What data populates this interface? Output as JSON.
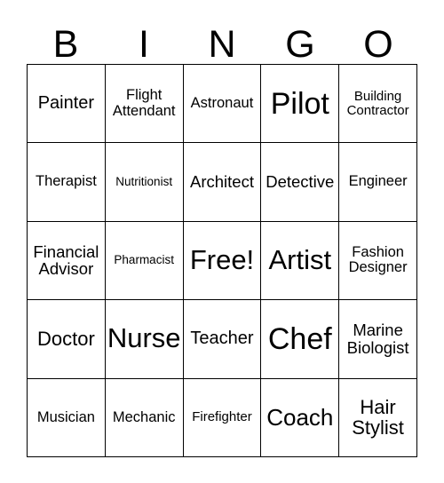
{
  "card": {
    "title": "BINGO",
    "header_letters": [
      "B",
      "I",
      "N",
      "G",
      "O"
    ],
    "border_color": "#000000",
    "background_color": "#ffffff",
    "text_color": "#000000",
    "rows": 5,
    "columns": 5,
    "free_space": "Free!",
    "cells": [
      {
        "label": "Painter",
        "size": "ml"
      },
      {
        "label": "Flight Attendant",
        "size": "sm"
      },
      {
        "label": "Astronaut",
        "size": "sm"
      },
      {
        "label": "Pilot",
        "size": "huge"
      },
      {
        "label": "Building Contractor",
        "size": "s"
      },
      {
        "label": "Therapist",
        "size": "sm"
      },
      {
        "label": "Nutritionist",
        "size": "xs"
      },
      {
        "label": "Architect",
        "size": "m"
      },
      {
        "label": "Detective",
        "size": "m"
      },
      {
        "label": "Engineer",
        "size": "sm"
      },
      {
        "label": "Financial Advisor",
        "size": "m"
      },
      {
        "label": "Pharmacist",
        "size": "xs"
      },
      {
        "label": "Free!",
        "size": "xxl"
      },
      {
        "label": "Artist",
        "size": "xxl"
      },
      {
        "label": "Fashion Designer",
        "size": "sm"
      },
      {
        "label": "Doctor",
        "size": "l"
      },
      {
        "label": "Nurse",
        "size": "xxl"
      },
      {
        "label": "Teacher",
        "size": "ml"
      },
      {
        "label": "Chef",
        "size": "huge"
      },
      {
        "label": "Marine Biologist",
        "size": "m"
      },
      {
        "label": "Musician",
        "size": "sm"
      },
      {
        "label": "Mechanic",
        "size": "sm"
      },
      {
        "label": "Firefighter",
        "size": "s"
      },
      {
        "label": "Coach",
        "size": "xl"
      },
      {
        "label": "Hair Stylist",
        "size": "l"
      }
    ]
  }
}
